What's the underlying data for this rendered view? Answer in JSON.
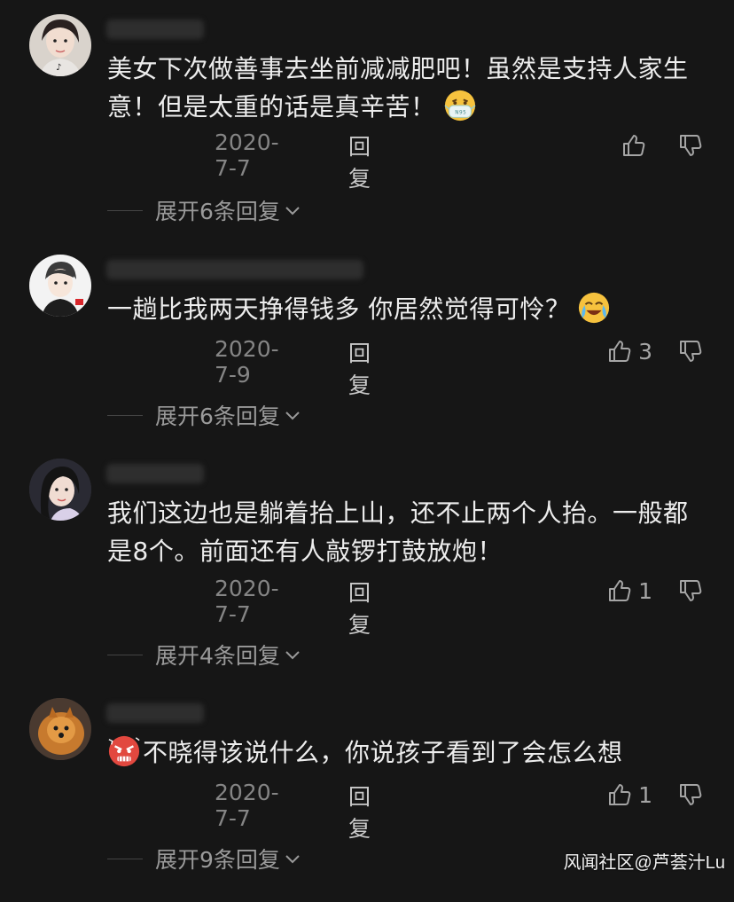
{
  "comments": [
    {
      "username": "",
      "text": "美女下次做善事去坐前减减肥吧！虽然是支持人家生意！但是太重的话是真辛苦！",
      "emoji": "mask-face-emoji",
      "date": "2020-7-7",
      "reply_label": "回复",
      "likes": "",
      "expand_label": "展开6条回复"
    },
    {
      "username": "",
      "text": "一趟比我两天挣得钱多 你居然觉得可怜？",
      "emoji": "crying-laughing-emoji",
      "date": "2020-7-9",
      "reply_label": "回复",
      "likes": "3",
      "expand_label": "展开6条回复"
    },
    {
      "username": "",
      "text": "我们这边也是躺着抬上山，还不止两个人抬。一般都是8个。前面还有人敲锣打鼓放炮！",
      "date": "2020-7-7",
      "reply_label": "回复",
      "likes": "1",
      "expand_label": "展开4条回复"
    },
    {
      "username": "",
      "text": "不晓得该说什么，你说孩子看到了会怎么想",
      "emoji": "angry-face-emoji",
      "date": "2020-7-7",
      "reply_label": "回复",
      "likes": "1",
      "expand_label": "展开9条回复"
    }
  ],
  "watermark": "风闻社区@芦荟汁Lu",
  "colors": {
    "background": "#161616",
    "text": "#ededed",
    "meta": "#858585",
    "reply": "#c9c9c9"
  }
}
